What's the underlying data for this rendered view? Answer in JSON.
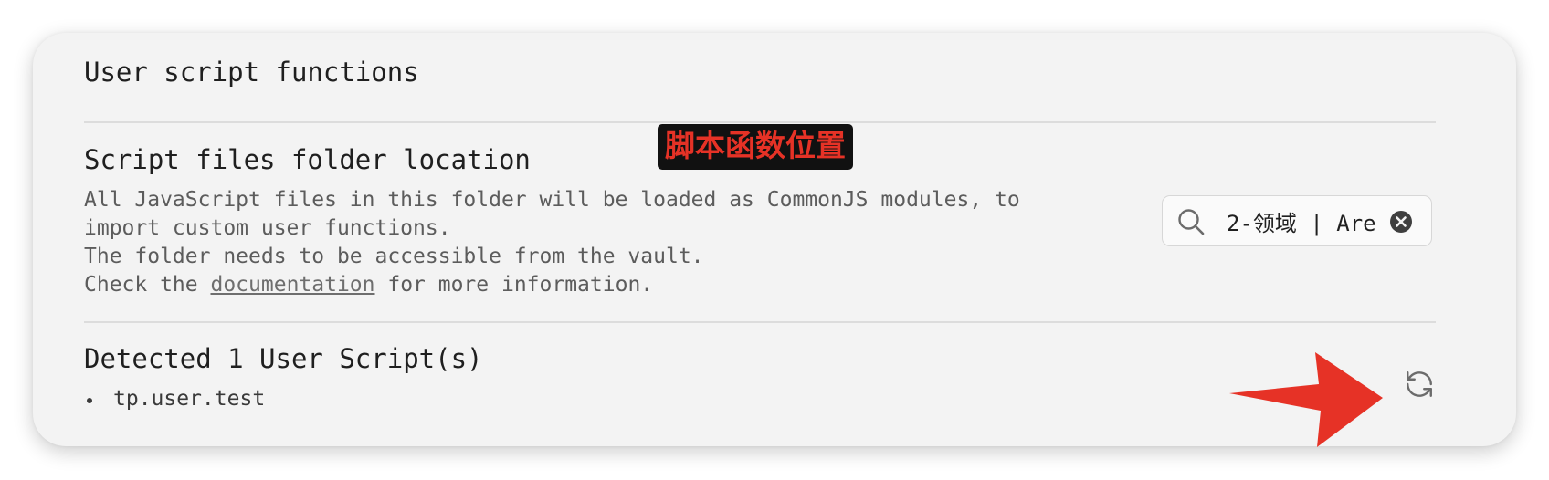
{
  "section": {
    "title": "User script functions"
  },
  "folder_setting": {
    "name": "Script files folder location",
    "description_lines": [
      "All JavaScript files in this folder will be loaded as CommonJS modules, to",
      "import custom user functions.",
      "The folder needs to be accessible from the vault."
    ],
    "info_prefix": "Check the ",
    "info_link": "documentation",
    "info_suffix": " for more information.",
    "input_value": "2-领域 | Are",
    "annotation": "脚本函数位置"
  },
  "detected_setting": {
    "name": "Detected 1 User Script(s)",
    "scripts": [
      "tp.user.test"
    ]
  },
  "icons": {
    "search": "search-icon",
    "clear": "clear-circle-icon",
    "refresh": "refresh-icon",
    "arrow": "red-arrow-annotation"
  },
  "colors": {
    "annotation_text": "#e63226",
    "annotation_bg": "#111111",
    "arrow": "#e63226"
  }
}
